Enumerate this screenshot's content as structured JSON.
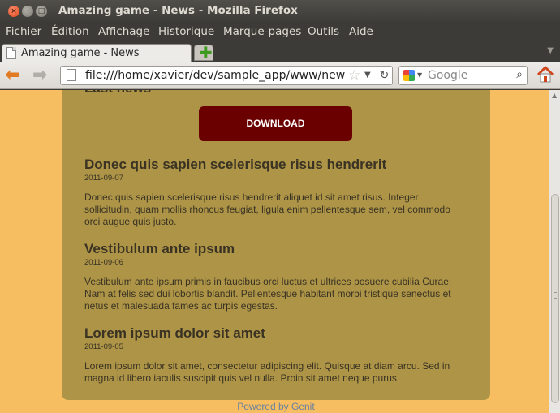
{
  "window": {
    "title": "Amazing game - News - Mozilla Firefox"
  },
  "menubar": {
    "items": [
      "Fichier",
      "Édition",
      "Affichage",
      "Historique",
      "Marque-pages",
      "Outils",
      "Aide"
    ]
  },
  "tab": {
    "label": "Amazing game - News"
  },
  "navbar": {
    "url": "file:///home/xavier/dev/sample_app/www/news.ht",
    "search_placeholder": "Google"
  },
  "page": {
    "cut_heading": "Last news",
    "download_label": "DOWNLOAD",
    "articles": [
      {
        "title": "Donec quis sapien scelerisque risus hendrerit",
        "date": "2011-09-07",
        "body": "Donec quis sapien scelerisque risus hendrerit aliquet id sit amet risus. Integer sollicitudin, quam mollis rhoncus feugiat, ligula enim pellentesque sem, vel commodo orci augue quis justo."
      },
      {
        "title": "Vestibulum ante ipsum",
        "date": "2011-09-06",
        "body": "Vestibulum ante ipsum primis in faucibus orci luctus et ultrices posuere cubilia Curae; Nam at felis sed dui lobortis blandit. Pellentesque habitant morbi tristique senectus et netus et malesuada fames ac turpis egestas."
      },
      {
        "title": "Lorem ipsum dolor sit amet",
        "date": "2011-09-05",
        "body": "Lorem ipsum dolor sit amet, consectetur adipiscing elit. Quisque at diam arcu. Sed in magna id libero iaculis suscipit quis vel nulla. Proin sit amet neque purus"
      }
    ],
    "footer": "Powered by Genit"
  },
  "colors": {
    "page_background": "#f6be60",
    "card_background": "#ad9447",
    "download_button": "#6b0000",
    "footer_link": "#6880a0"
  }
}
